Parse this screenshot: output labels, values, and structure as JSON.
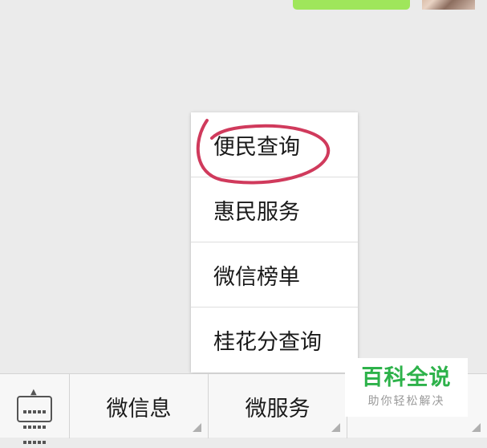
{
  "menu": {
    "items": [
      {
        "label": "便民查询"
      },
      {
        "label": "惠民服务"
      },
      {
        "label": "微信榜单"
      },
      {
        "label": "桂花分查询"
      }
    ]
  },
  "bottom_bar": {
    "keyboard_icon": "keyboard-icon",
    "tabs": [
      {
        "label": "微信息"
      },
      {
        "label": "微服务"
      },
      {
        "label": ""
      }
    ]
  },
  "watermark": {
    "title": "百科全说",
    "subtitle": "助你轻松解决"
  },
  "colors": {
    "annotation": "#d03a5c",
    "watermark_green": "#2db24a",
    "bubble_green": "#9fe65b"
  }
}
